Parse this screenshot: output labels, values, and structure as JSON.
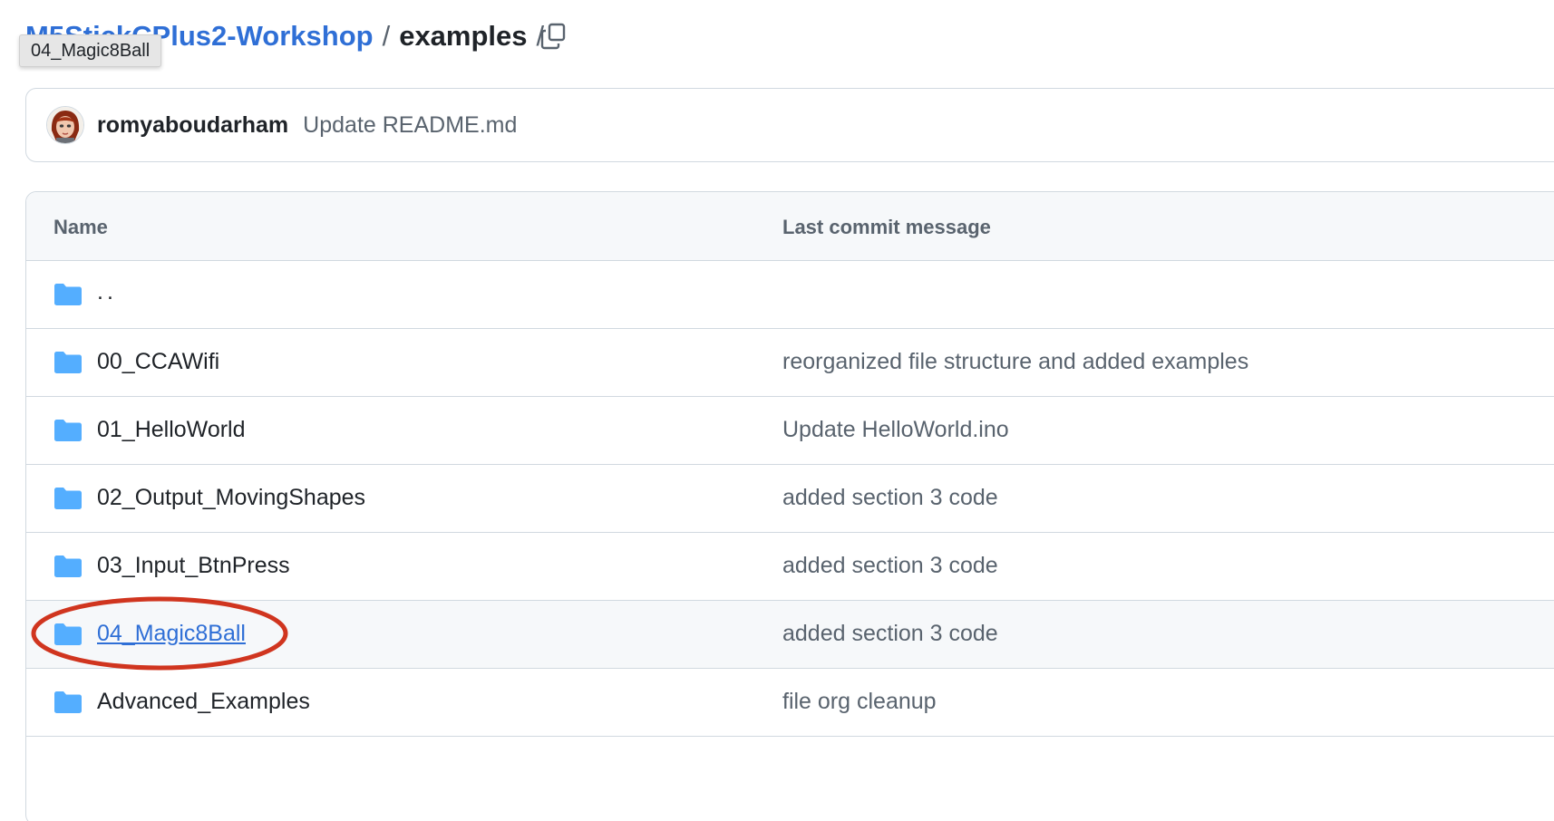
{
  "breadcrumb": {
    "repo": "M5StickCPlus2-Workshop",
    "folder": "examples",
    "separator": "/",
    "trailing_separator": "/"
  },
  "tooltip": {
    "text": "04_Magic8Ball"
  },
  "latest_commit": {
    "author": "romyaboudarham",
    "message": "Update README.md"
  },
  "table": {
    "headers": {
      "name": "Name",
      "last_commit_message": "Last commit message"
    },
    "rows": [
      {
        "name": "..",
        "message": ""
      },
      {
        "name": "00_CCAWifi",
        "message": "reorganized file structure and added examples"
      },
      {
        "name": "01_HelloWorld",
        "message": "Update HelloWorld.ino"
      },
      {
        "name": "02_Output_MovingShapes",
        "message": "added section 3 code"
      },
      {
        "name": "03_Input_BtnPress",
        "message": "added section 3 code"
      },
      {
        "name": "04_Magic8Ball",
        "message": "added section 3 code"
      },
      {
        "name": "Advanced_Examples",
        "message": "file org cleanup"
      }
    ]
  },
  "icons": {
    "folder": "folder-icon",
    "copy": "copy-icon",
    "avatar": "avatar"
  },
  "colors": {
    "link": "#2f6fd6",
    "folder": "#54aeff",
    "annotation": "#d0351f",
    "muted": "#59636e",
    "border": "#d1d9e0"
  }
}
